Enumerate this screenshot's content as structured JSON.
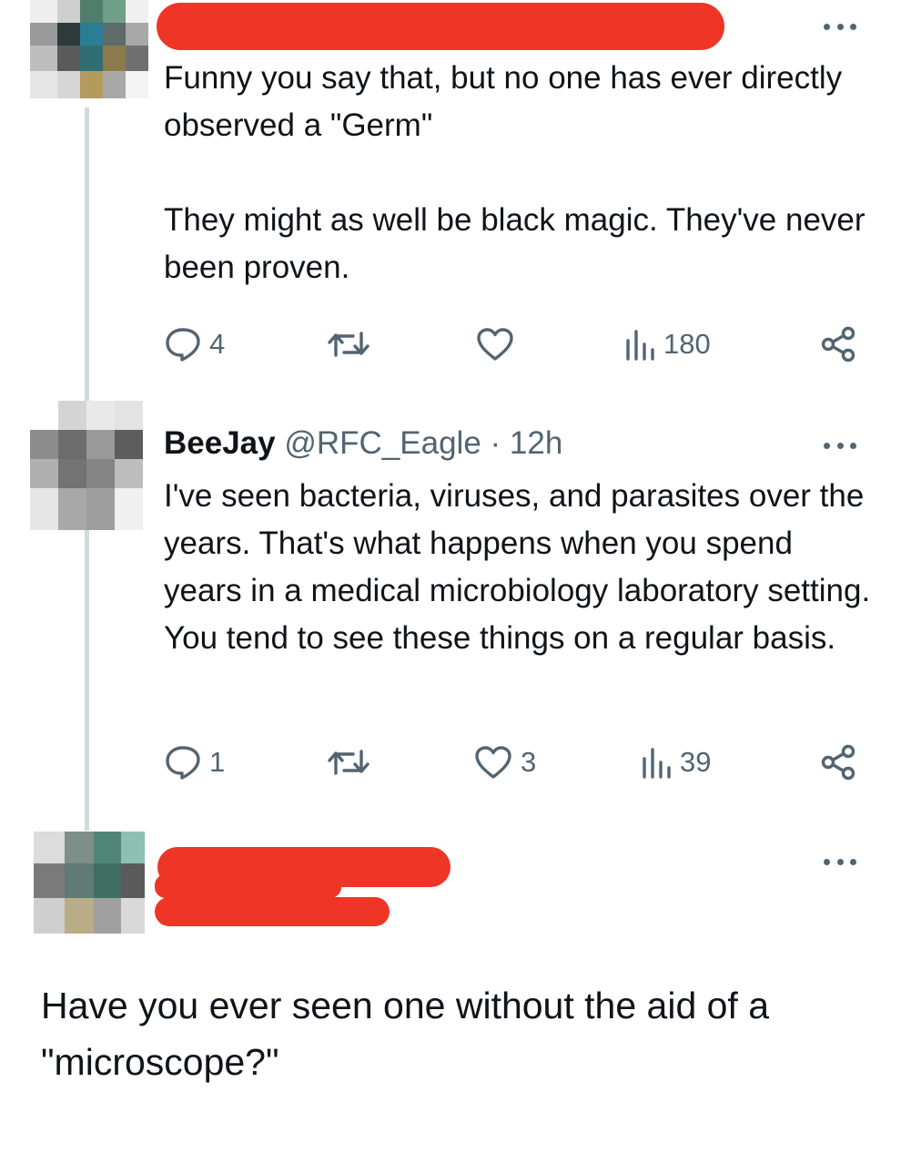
{
  "tweets": [
    {
      "text": "Funny you say that, but no one has ever directly observed a \"Germ\"\n\nThey might as well be black magic. They've never been proven.",
      "replies": "4",
      "retweets": "",
      "likes": "",
      "views": "180"
    },
    {
      "author_name": "BeeJay",
      "author_handle": "@RFC_Eagle",
      "separator": "·",
      "time": "12h",
      "text": "I've seen bacteria, viruses, and parasites over the years. That's what happens when you spend years in a medical microbiology laboratory setting. You tend to see these things on a regular basis.",
      "replies": "1",
      "retweets": "",
      "likes": "3",
      "views": "39"
    },
    {
      "text": "Have you ever seen one without the aid of a \"microscope?\""
    }
  ],
  "icons": {
    "reply": "reply-icon",
    "retweet": "retweet-icon",
    "like": "heart-icon",
    "views": "views-icon",
    "share": "share-icon",
    "more": "more-icon"
  },
  "colors": {
    "text": "#0f1419",
    "secondary": "#536471",
    "thread_line": "#cfd9de",
    "redaction": "#ee3526"
  }
}
